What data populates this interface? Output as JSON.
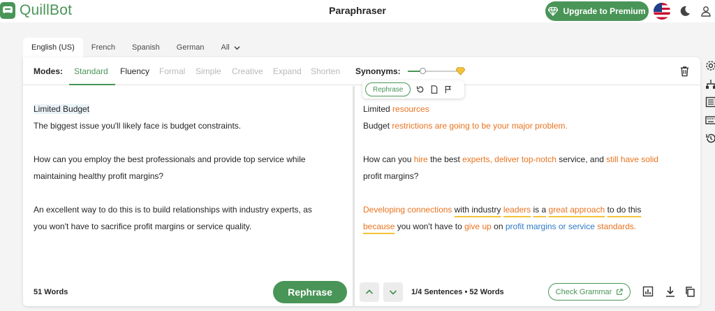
{
  "app": {
    "name": "QuillBot",
    "title": "Paraphraser",
    "premium_label": "Upgrade to Premium"
  },
  "languages": [
    {
      "label": "English (US)",
      "active": true
    },
    {
      "label": "French"
    },
    {
      "label": "Spanish"
    },
    {
      "label": "German"
    },
    {
      "label": "All"
    }
  ],
  "modes": {
    "label": "Modes:",
    "items": [
      "Standard",
      "Fluency",
      "Formal",
      "Simple",
      "Creative",
      "Expand",
      "Shorten"
    ],
    "active": "Standard",
    "synonyms_label": "Synonyms:",
    "synonyms_level": 0.3
  },
  "input": {
    "title": "Limited Budget",
    "p1": "The biggest issue you'll likely face is budget constraints.",
    "p2a": "How can you employ the best professionals and provide top service while",
    "p2b": "maintaining healthy profit margins?",
    "p3a": "An excellent way to do this is to build relationships with industry experts, as",
    "p3b": "you won't have to sacrifice profit margins or service quality.",
    "word_count": "51 Words",
    "rephrase_label": "Rephrase"
  },
  "output": {
    "t1": "Limited",
    "t2": "resources",
    "a1": "Budget",
    "a2": "restrictions are going to be your major problem.",
    "b1": "How can you",
    "b2": "hire",
    "b3": "the best",
    "b4": "experts, deliver top-notch",
    "b5": "service, and",
    "b6": "still have solid",
    "b7": "profit margins?",
    "c1": "Developing connections",
    "c2": "with industry",
    "c3": "leaders",
    "c4": "is a",
    "c5": "great approach",
    "c6": "to do this",
    "c7": "because",
    "c8": "you won't have to",
    "c9": "give up",
    "c10": "on",
    "c11": "profit margins or service",
    "c12": "standards.",
    "popup_rephrase": "Rephrase",
    "sentences": "1/4 Sentences",
    "separator": "•",
    "word_count": "52 Words",
    "grammar_label": "Check Grammar"
  },
  "colors": {
    "brand": "#499557",
    "changed": "#e8731f",
    "structural": "#2e7ac6",
    "longest_unchanged": "#f3c33a"
  }
}
